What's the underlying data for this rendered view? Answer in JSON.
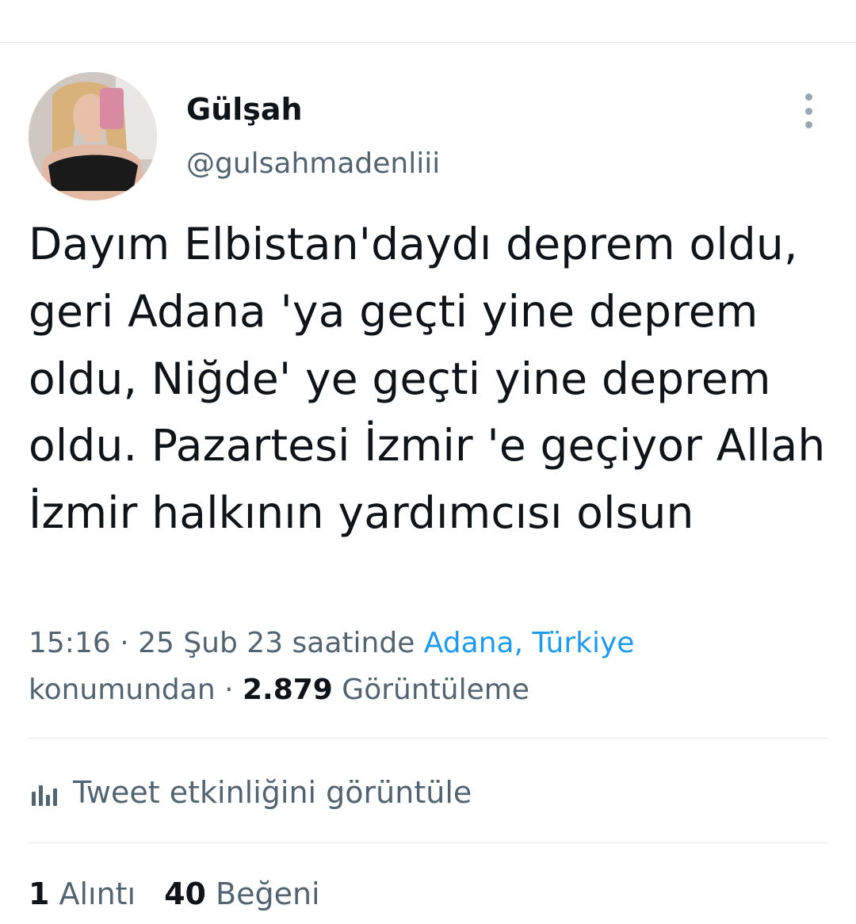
{
  "user": {
    "display_name": "Gülşah",
    "handle": "@gulsahmadenliii"
  },
  "tweet": {
    "text": "Dayım Elbistan'daydı deprem oldu, geri Adana 'ya geçti yine deprem oldu, Niğde' ye geçti yine deprem oldu. Pazartesi İzmir 'e geçiyor Allah İzmir halkının yardımcısı olsun",
    "time_prefix": "15:16 · 25 Şub 23 saatinde ",
    "location": "Adana, Türkiye",
    "location_suffix": " konumundan · ",
    "views_count": "2.879",
    "views_label": " Görüntüleme"
  },
  "activity": {
    "label": "Tweet etkinliğini görüntüle"
  },
  "stats": {
    "quotes_count": "1",
    "quotes_label": "Alıntı",
    "likes_count": "40",
    "likes_label": "Beğeni"
  },
  "icons": {
    "more": "more-vertical-icon",
    "activity": "bar-chart-icon"
  },
  "colors": {
    "accent": "#1d9bf0",
    "secondary_text": "#536471",
    "primary_text": "#0f1419",
    "divider": "#e3e6e8"
  }
}
